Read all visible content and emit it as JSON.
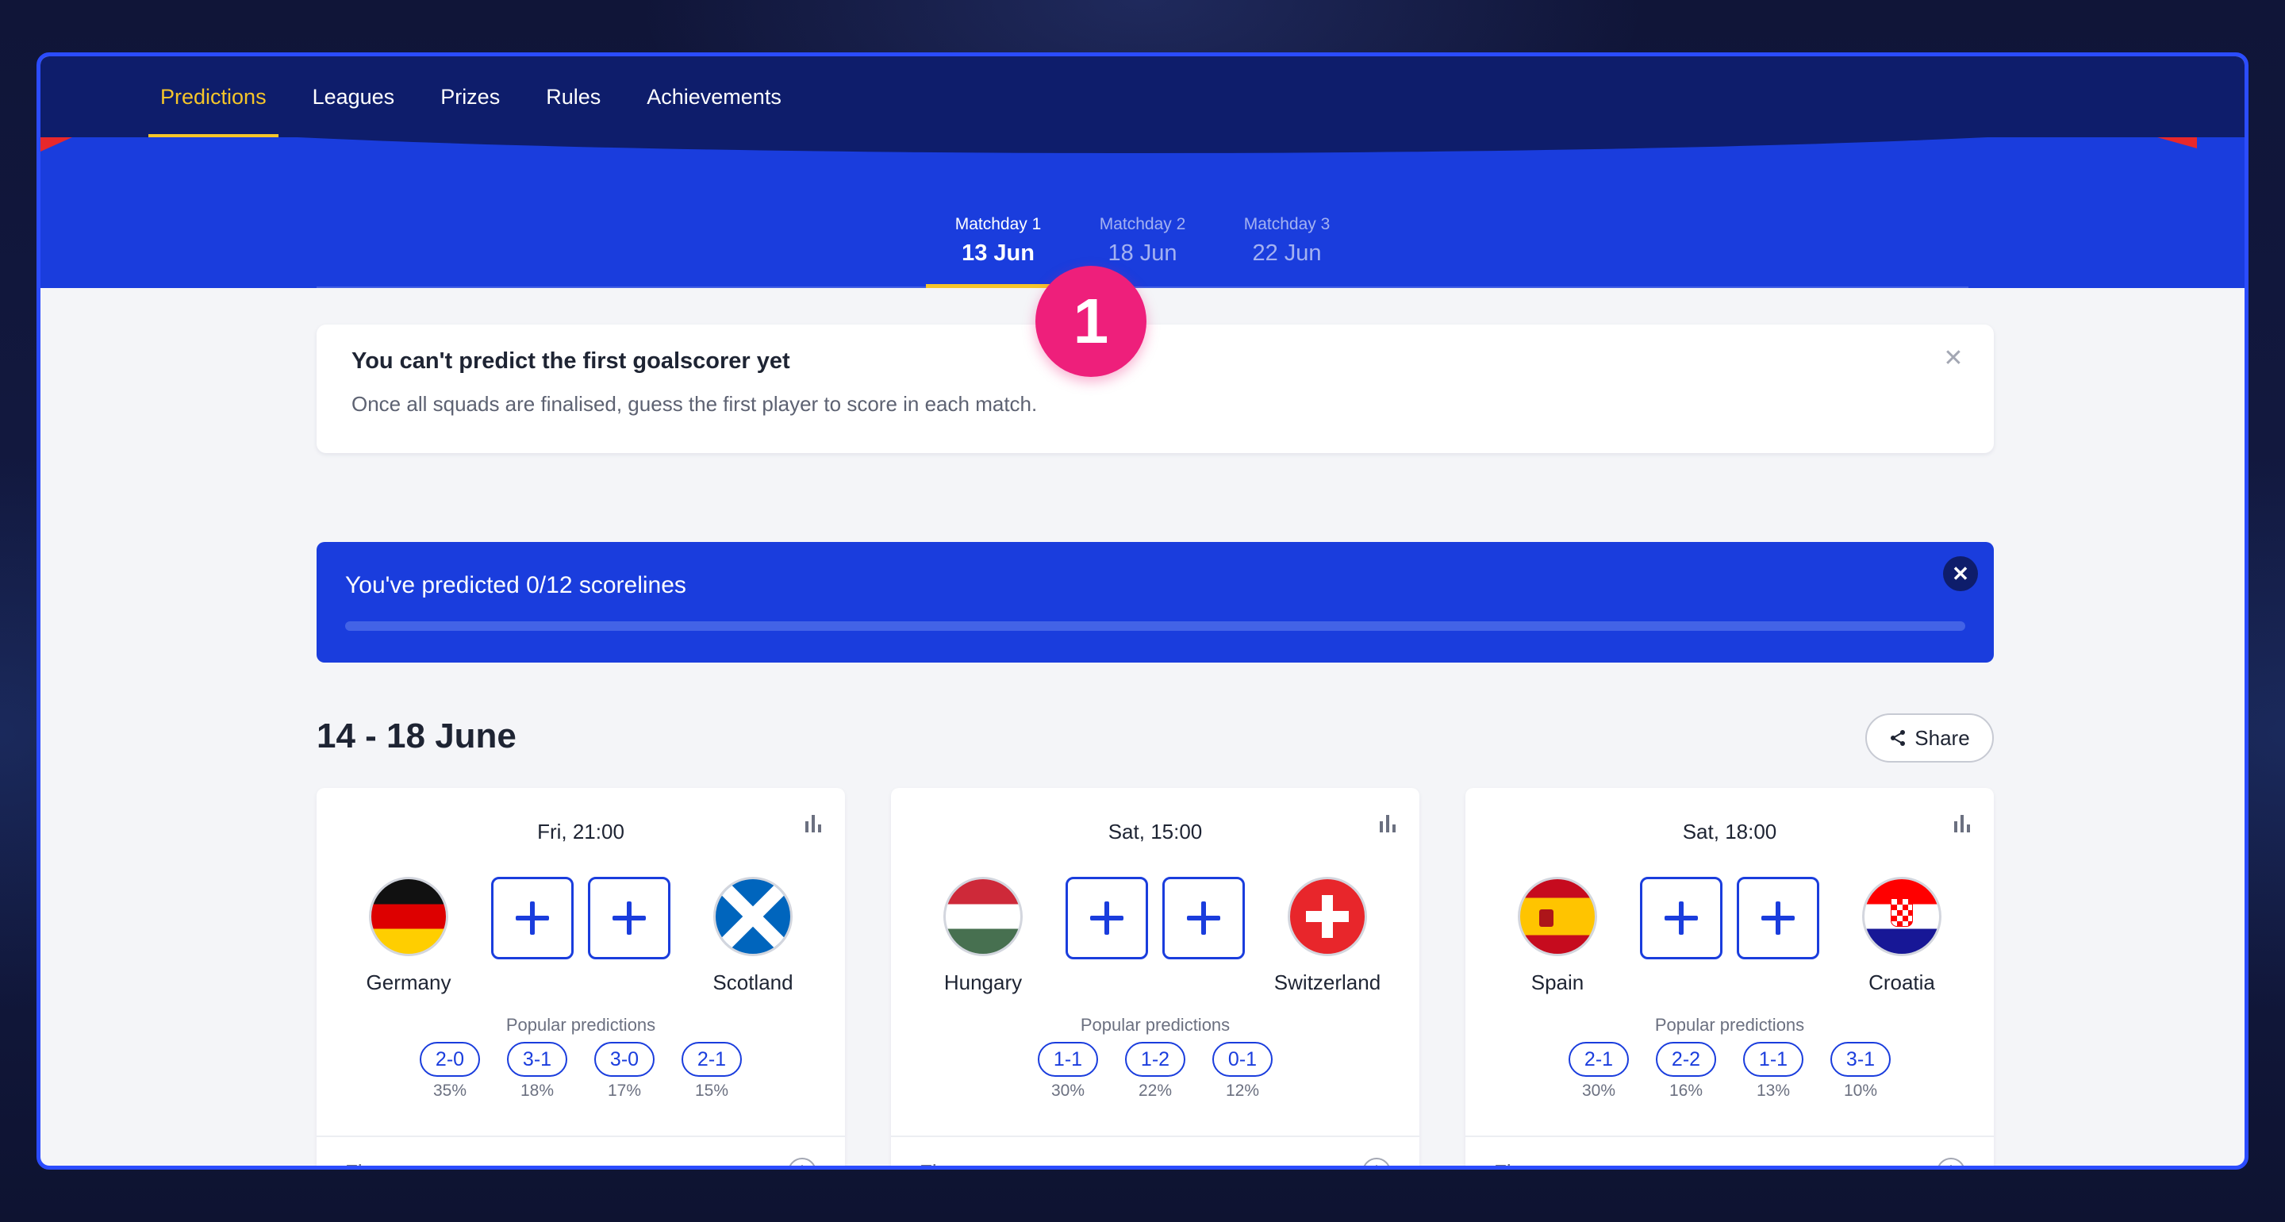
{
  "nav": {
    "items": [
      {
        "label": "Predictions",
        "active": true
      },
      {
        "label": "Leagues",
        "active": false
      },
      {
        "label": "Prizes",
        "active": false
      },
      {
        "label": "Rules",
        "active": false
      },
      {
        "label": "Achievements",
        "active": false
      }
    ]
  },
  "matchdays": [
    {
      "label": "Matchday 1",
      "date": "13 Jun",
      "active": true
    },
    {
      "label": "Matchday 2",
      "date": "18 Jun",
      "active": false
    },
    {
      "label": "Matchday 3",
      "date": "22 Jun",
      "active": false
    }
  ],
  "badge": {
    "number": "1",
    "color": "#ee1f7b"
  },
  "info": {
    "title": "You can't predict the first goalscorer yet",
    "body": "Once all squads are finalised, guess the first player to score in each match.",
    "close": "✕"
  },
  "progress": {
    "title": "You've predicted 0/12 scorelines",
    "fraction": 0,
    "close": "✕"
  },
  "section": {
    "title": "14 - 18 June",
    "share_label": "Share"
  },
  "matches": [
    {
      "time": "Fri, 21:00",
      "home": {
        "name": "Germany",
        "flag": "germany-flag"
      },
      "away": {
        "name": "Scotland",
        "flag": "scotland-flag"
      },
      "popular_title": "Popular predictions",
      "popular": [
        {
          "score": "2-0",
          "pct": "35%"
        },
        {
          "score": "3-1",
          "pct": "18%"
        },
        {
          "score": "3-0",
          "pct": "17%"
        },
        {
          "score": "2-1",
          "pct": "15%"
        }
      ],
      "first_team_label": "First team to score"
    },
    {
      "time": "Sat, 15:00",
      "home": {
        "name": "Hungary",
        "flag": "hungary-flag"
      },
      "away": {
        "name": "Switzerland",
        "flag": "switzerland-flag"
      },
      "popular_title": "Popular predictions",
      "popular": [
        {
          "score": "1-1",
          "pct": "30%"
        },
        {
          "score": "1-2",
          "pct": "22%"
        },
        {
          "score": "0-1",
          "pct": "12%"
        }
      ],
      "first_team_label": "First team to score"
    },
    {
      "time": "Sat, 18:00",
      "home": {
        "name": "Spain",
        "flag": "spain-flag"
      },
      "away": {
        "name": "Croatia",
        "flag": "croatia-flag"
      },
      "popular_title": "Popular predictions",
      "popular": [
        {
          "score": "2-1",
          "pct": "30%"
        },
        {
          "score": "2-2",
          "pct": "16%"
        },
        {
          "score": "1-1",
          "pct": "13%"
        },
        {
          "score": "3-1",
          "pct": "10%"
        }
      ],
      "first_team_label": "First team to score"
    }
  ],
  "colors": {
    "navy": "#0e1d6b",
    "blue": "#1a3ddd",
    "accent_yellow": "#f5c52a",
    "badge_pink": "#ee1f7b"
  }
}
